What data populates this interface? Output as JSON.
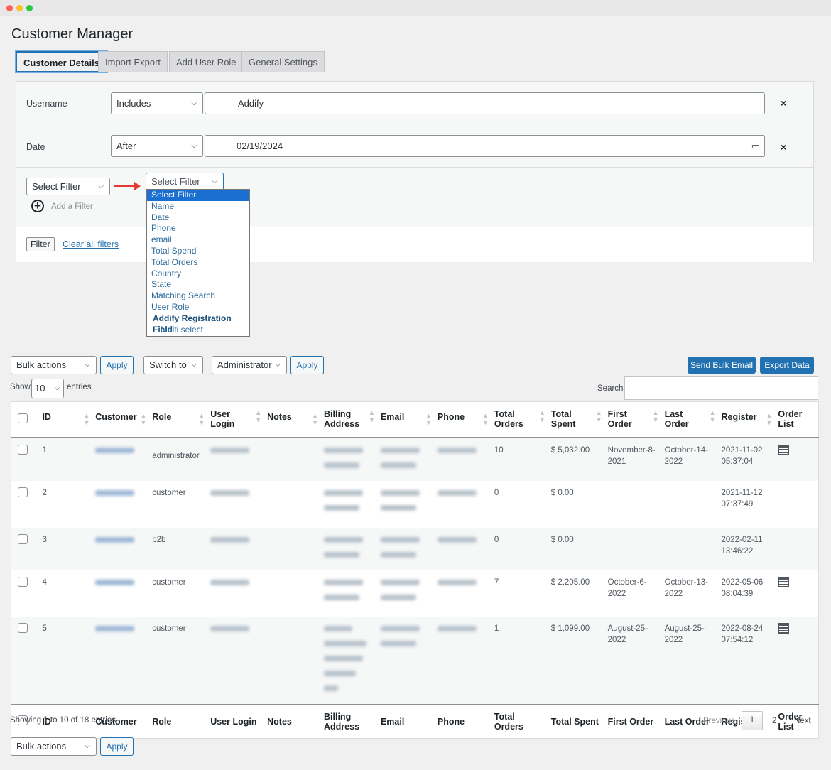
{
  "title": "Customer Manager",
  "tabs": [
    "Customer Details",
    "Import Export",
    "Add User Role",
    "General Settings"
  ],
  "filters": [
    {
      "label": "Username",
      "operator": "Includes",
      "value": "Addify"
    },
    {
      "label": "Date",
      "operator": "After",
      "value": "02/19/2024"
    }
  ],
  "new_filter": {
    "select1": "Select Filter",
    "select2": "Select Filter",
    "add_label": "Add a Filter"
  },
  "dropdown_options": [
    "Select Filter",
    "Name",
    "Date",
    "Phone",
    "email",
    "Total Spend",
    "Total Orders",
    "Country",
    "State",
    "Matching Search",
    "User Role"
  ],
  "dropdown_group": "Addify Registration Field",
  "dropdown_group_options": [
    "Multi select"
  ],
  "filter_button": "Filter",
  "clear_filters": "Clear all filters",
  "toolbar": {
    "bulk": "Bulk actions",
    "apply": "Apply",
    "switch": "Switch to",
    "role": "Administrator",
    "send_email": "Send Bulk Email",
    "export": "Export Data",
    "show": "Show",
    "entries_count": "10",
    "entries": "entries",
    "search": "Search:"
  },
  "columns": [
    "ID",
    "Customer",
    "Role",
    "User Login",
    "Notes",
    "Billing Address",
    "Email",
    "Phone",
    "Total Orders",
    "Total Spent",
    "First Order",
    "Last Order",
    "Register",
    "Order List"
  ],
  "rows": [
    {
      "id": "1",
      "role": "administrator",
      "orders": "10",
      "spent": "$ 5,032.00",
      "first": "November-8-2021",
      "last": "October-14-2022",
      "register": "2021-11-02 05:37:04",
      "list": true
    },
    {
      "id": "2",
      "role": "customer",
      "orders": "0",
      "spent": "$ 0.00",
      "first": "",
      "last": "",
      "register": "2021-11-12 07:37:49",
      "list": false
    },
    {
      "id": "3",
      "role": "b2b",
      "orders": "0",
      "spent": "$ 0.00",
      "first": "",
      "last": "",
      "register": "2022-02-11 13:46:22",
      "list": false
    },
    {
      "id": "4",
      "role": "customer",
      "orders": "7",
      "spent": "$ 2,205.00",
      "first": "October-6-2022",
      "last": "October-13-2022",
      "register": "2022-05-06 08:04:39",
      "list": true
    },
    {
      "id": "5",
      "role": "customer",
      "orders": "1",
      "spent": "$ 1,099.00",
      "first": "August-25-2022",
      "last": "August-25-2022",
      "register": "2022-08-24 07:54:12",
      "list": true
    }
  ],
  "footer": {
    "showing": "Showing 1 to 10 of 18 entries",
    "previous": "Previous",
    "pages": [
      "1",
      "2"
    ],
    "next": "Next"
  },
  "accent": "#2271b1"
}
